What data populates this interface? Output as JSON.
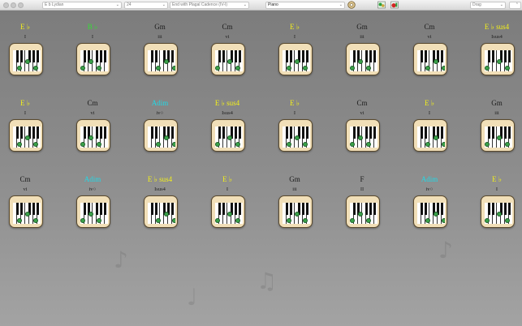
{
  "toolbar": {
    "mode": "E b Lydian",
    "bars": "24",
    "cadence": "End with Plagal Cadence (IV-I)",
    "instrument": "Piano",
    "search_placeholder": "Drag"
  },
  "colors": {
    "yellow": "#f2ef1c",
    "green": "#33dd33",
    "cyan": "#22d8e6",
    "dark": "#1d1d1d",
    "key_dot": "#3aa14a"
  },
  "rows": [
    [
      {
        "name": "E ♭",
        "roman": "I",
        "color": "yellow"
      },
      {
        "name": "B ♭",
        "roman": "I",
        "color": "green"
      },
      {
        "name": "Gm",
        "roman": "iii",
        "color": "dark"
      },
      {
        "name": "Cm",
        "roman": "vi",
        "color": "dark"
      },
      {
        "name": "E ♭",
        "roman": "I",
        "color": "yellow"
      },
      {
        "name": "Gm",
        "roman": "iii",
        "color": "dark"
      },
      {
        "name": "Cm",
        "roman": "vi",
        "color": "dark"
      },
      {
        "name": "E ♭ sus4",
        "roman": "Isus4",
        "color": "yellow"
      }
    ],
    [
      {
        "name": "E ♭",
        "roman": "I",
        "color": "yellow"
      },
      {
        "name": "Cm",
        "roman": "vi",
        "color": "dark"
      },
      {
        "name": "Adim",
        "roman": "iv○",
        "color": "cyan"
      },
      {
        "name": "E ♭ sus4",
        "roman": "Isus4",
        "color": "yellow"
      },
      {
        "name": "E ♭",
        "roman": "I",
        "color": "yellow"
      },
      {
        "name": "Cm",
        "roman": "vi",
        "color": "dark"
      },
      {
        "name": "E ♭",
        "roman": "I",
        "color": "yellow"
      },
      {
        "name": "Gm",
        "roman": "iii",
        "color": "dark"
      }
    ],
    [
      {
        "name": "Cm",
        "roman": "vi",
        "color": "dark"
      },
      {
        "name": "Adim",
        "roman": "iv○",
        "color": "cyan"
      },
      {
        "name": "E ♭ sus4",
        "roman": "Isus4",
        "color": "yellow"
      },
      {
        "name": "E ♭",
        "roman": "I",
        "color": "yellow"
      },
      {
        "name": "Gm",
        "roman": "iii",
        "color": "dark"
      },
      {
        "name": "F",
        "roman": "II",
        "color": "dark"
      },
      {
        "name": "Adim",
        "roman": "iv○",
        "color": "cyan"
      },
      {
        "name": "E ♭",
        "roman": "I",
        "color": "yellow"
      }
    ]
  ]
}
